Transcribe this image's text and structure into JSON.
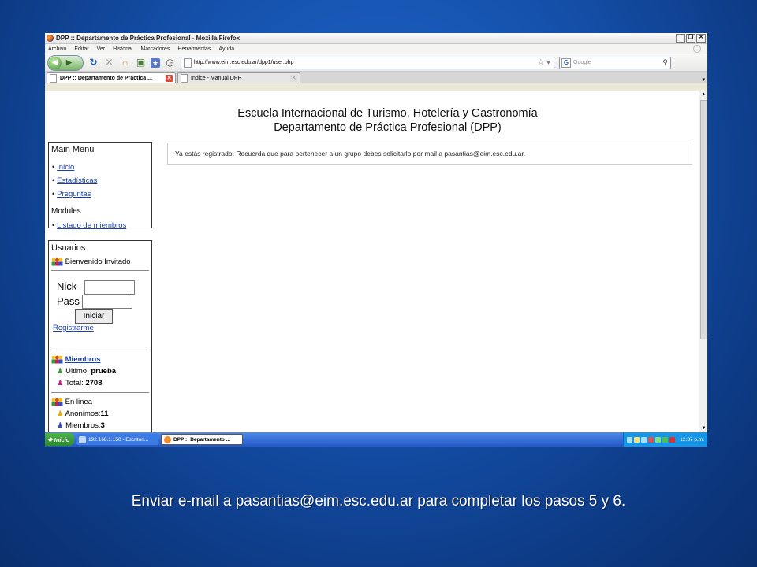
{
  "window": {
    "title": "DPP :: Departamento de Práctica Profesional - Mozilla Firefox"
  },
  "menubar": [
    "Archivo",
    "Editar",
    "Ver",
    "Historial",
    "Marcadores",
    "Herramientas",
    "Ayuda"
  ],
  "nav": {
    "url": "http://www.eim.esc.edu.ar/dpp1/user.php",
    "search_placeholder": "Google"
  },
  "tabs": [
    {
      "label": "DPP :: Departamento de Práctica ..."
    },
    {
      "label": "Indice - Manual DPP"
    }
  ],
  "page": {
    "header_line1": "Escuela Internacional de Turismo, Hotelería y Gastronomía",
    "header_line2": "Departamento de Práctica Profesional (DPP)",
    "message": "Ya estás registrado. Recuerda que para pertenecer a un grupo debes solicitarlo por mail a pasantias@eim.esc.edu.ar.",
    "main_menu": {
      "title": "Main Menu",
      "items": [
        "Inicio",
        "Estadísticas",
        "Preguntas"
      ],
      "modules_title": "Modules",
      "modules": [
        "Listado de miembros"
      ]
    },
    "users": {
      "title": "Usuarios",
      "welcome": "Bienvenido",
      "guest": "Invitado",
      "nick_label": "Nick",
      "pass_label": "Pass",
      "login_button": "Iniciar",
      "register_link": "Registrarme",
      "members_link": "Miembros",
      "last_label": "Ultimo:",
      "last_value": "prueba",
      "total_label": "Total:",
      "total_value": "2708",
      "online_title": "En linea",
      "anon_label": "Anonimos:",
      "anon_value": "11",
      "members_online_label": "Miembros:",
      "members_online_value": "3"
    }
  },
  "taskbar": {
    "start": "Inicio",
    "items": [
      "192.168.1.150 - Escritori...",
      "DPP :: Departamento ..."
    ],
    "clock": "12:37 p.m."
  },
  "caption": "Enviar e-mail a pasantias@eim.esc.edu.ar para completar los pasos 5 y 6."
}
